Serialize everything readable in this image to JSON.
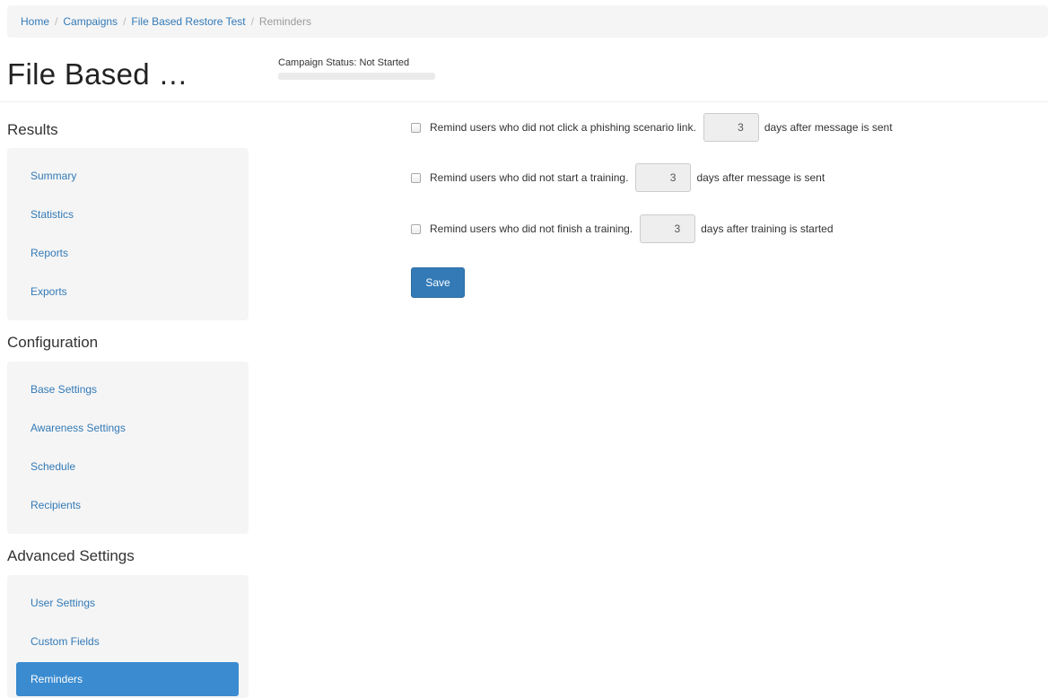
{
  "breadcrumb": {
    "items": [
      "Home",
      "Campaigns",
      "File Based Restore Test"
    ],
    "separator": "/",
    "current": "Reminders"
  },
  "page": {
    "title": "File Based …",
    "status_label": "Campaign Status:",
    "status_value": "Not Started"
  },
  "sidebar": {
    "results_heading": "Results",
    "results_items": [
      "Summary",
      "Statistics",
      "Reports",
      "Exports"
    ],
    "configuration_heading": "Configuration",
    "configuration_items": [
      "Base Settings",
      "Awareness Settings",
      "Schedule",
      "Recipients"
    ],
    "advanced_heading": "Advanced Settings",
    "advanced_items": [
      "User Settings",
      "Custom Fields",
      "Reminders"
    ],
    "active_item": "Reminders"
  },
  "reminders": [
    {
      "label": "Remind users who did not click a phishing scenario link.",
      "days": "3",
      "suffix": "days after message is sent",
      "checked": false
    },
    {
      "label": "Remind users who did not start a training.",
      "days": "3",
      "suffix": "days after message is sent",
      "checked": false
    },
    {
      "label": "Remind users who did not finish a training.",
      "days": "3",
      "suffix": "days after training is started",
      "checked": false
    }
  ],
  "actions": {
    "save_label": "Save"
  },
  "colors": {
    "link": "#337ab7",
    "active_nav": "#3a8bd0",
    "panel_bg": "#f5f5f5"
  }
}
